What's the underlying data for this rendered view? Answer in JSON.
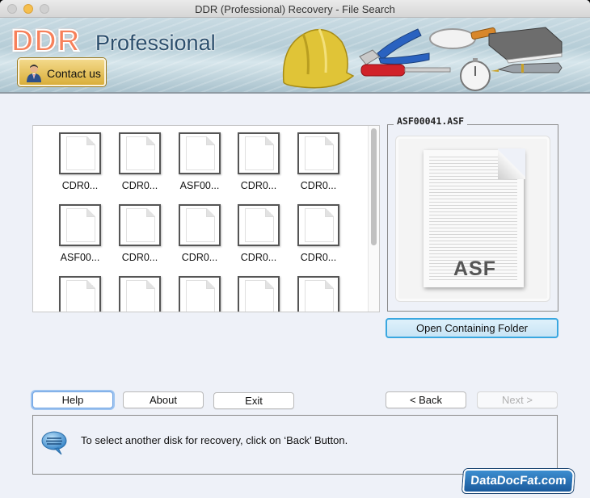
{
  "window": {
    "title": "DDR (Professional) Recovery - File Search"
  },
  "banner": {
    "brand": "DDR",
    "edition": "Professional",
    "contact_label": "Contact us",
    "tool_icons": [
      "hard-hat",
      "pliers",
      "magnifier",
      "book",
      "screwdriver",
      "stopwatch",
      "fountain-pen"
    ]
  },
  "file_list": {
    "items": [
      {
        "name": "CDR0...",
        "icon": "file-icon"
      },
      {
        "name": "CDR0...",
        "icon": "file-icon"
      },
      {
        "name": "ASF00...",
        "icon": "file-icon"
      },
      {
        "name": "CDR0...",
        "icon": "file-icon"
      },
      {
        "name": "CDR0...",
        "icon": "file-icon"
      },
      {
        "name": "ASF00...",
        "icon": "file-icon"
      },
      {
        "name": "CDR0...",
        "icon": "file-icon"
      },
      {
        "name": "CDR0...",
        "icon": "file-icon"
      },
      {
        "name": "CDR0...",
        "icon": "file-icon"
      },
      {
        "name": "CDR0...",
        "icon": "file-icon"
      },
      {
        "name": "",
        "icon": "file-icon"
      },
      {
        "name": "",
        "icon": "file-icon"
      },
      {
        "name": "",
        "icon": "file-icon"
      },
      {
        "name": "",
        "icon": "file-icon"
      },
      {
        "name": "",
        "icon": "file-icon"
      }
    ]
  },
  "preview": {
    "title": "ASF00041.ASF",
    "file_type": "ASF",
    "open_folder_label": "Open Containing Folder"
  },
  "buttons": {
    "help": "Help",
    "about": "About",
    "exit": "Exit",
    "back": "< Back",
    "next": "Next >"
  },
  "message": {
    "text": "To select another disk for recovery, click on ‘Back’ Button."
  },
  "watermark": {
    "text": "DataDocFat.com"
  }
}
